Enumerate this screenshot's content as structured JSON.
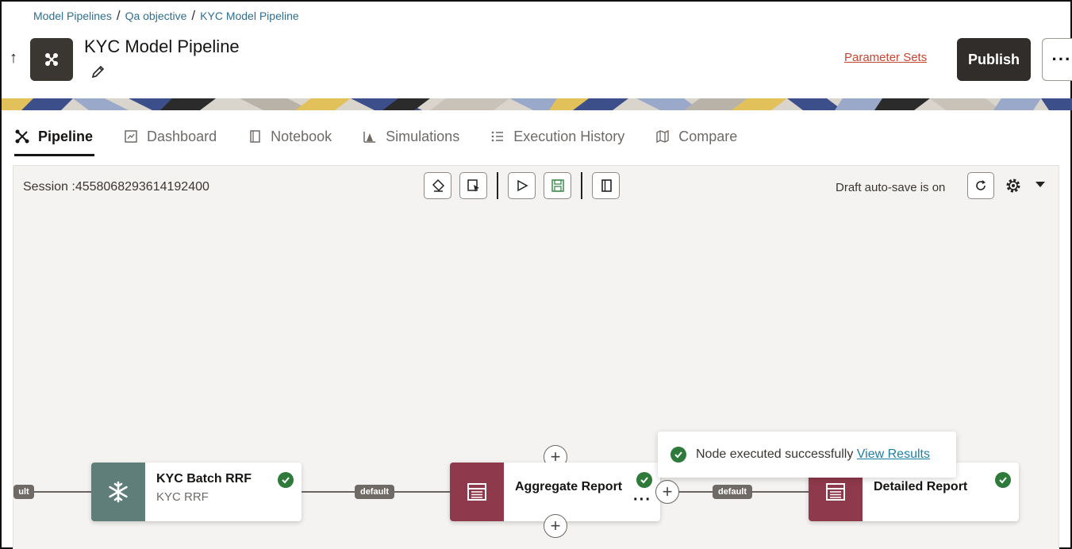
{
  "breadcrumb": {
    "items": [
      "Model Pipelines",
      "Qa objective",
      "KYC Model Pipeline"
    ],
    "separator": "/"
  },
  "header": {
    "title": "KYC Model Pipeline",
    "parameter_sets_label": "Parameter Sets",
    "publish_label": "Publish",
    "more_label": "···"
  },
  "tabs": [
    {
      "label": "Pipeline",
      "icon": "pipeline-icon",
      "active": true
    },
    {
      "label": "Dashboard",
      "icon": "dashboard-icon",
      "active": false
    },
    {
      "label": "Notebook",
      "icon": "notebook-icon",
      "active": false
    },
    {
      "label": "Simulations",
      "icon": "simulations-icon",
      "active": false
    },
    {
      "label": "Execution History",
      "icon": "list-icon",
      "active": false
    },
    {
      "label": "Compare",
      "icon": "map-icon",
      "active": false
    }
  ],
  "canvas": {
    "session": "Session :4558068293614192400",
    "autosave": "Draft auto-save is on",
    "toolbar_icons": [
      "eraser-icon",
      "select-icon",
      "run-icon",
      "save-icon",
      "book-icon"
    ]
  },
  "graph": {
    "edge_labels": [
      "ult",
      "default",
      "default"
    ],
    "nodes": [
      {
        "title": "KYC Batch RRF",
        "subtitle": "KYC RRF",
        "icon": "snowflake-icon",
        "color": "#5f7d79",
        "status": "success"
      },
      {
        "title": "Aggregate Report",
        "subtitle": "",
        "icon": "table-icon",
        "color": "#8f3a4c",
        "status": "success"
      },
      {
        "title": "Detailed Report",
        "subtitle": "",
        "icon": "table-icon",
        "color": "#8f3a4c",
        "status": "success"
      }
    ]
  },
  "toast": {
    "message": "Node executed successfully",
    "link": "View Results"
  },
  "colors": {
    "primary_dark": "#312d2a",
    "link_orange": "#c74634",
    "link_blue": "#1e7fa6",
    "success": "#2d7a3a",
    "node_teal": "#5f7d79",
    "node_wine": "#8f3a4c"
  }
}
